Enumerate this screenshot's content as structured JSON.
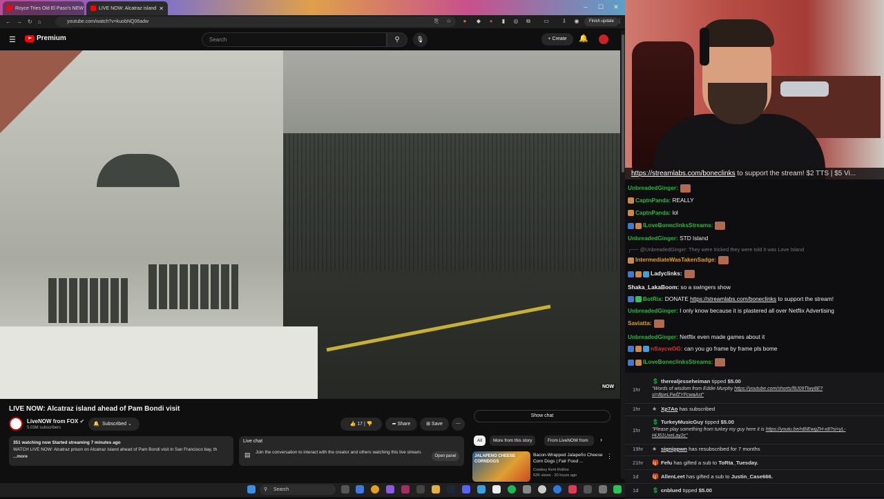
{
  "browser": {
    "tabs": [
      {
        "label": "Royce Tries Old El Paso's NEW"
      },
      {
        "label": "LIVE NOW: Alcatraz island"
      }
    ],
    "url": "youtube.com/watch?v=kuobNQ06adw",
    "finish_update": "Finish update"
  },
  "youtube": {
    "logo_text": "Premium",
    "search_placeholder": "Search",
    "create_label": "Create",
    "video": {
      "watermark": "NOW",
      "title": "LIVE NOW: Alcatraz island ahead of Pam Bondi visit",
      "channel": "LiveNOW from FOX",
      "subscribers": "5.03M subscribers",
      "subscribed_label": "Subscribed",
      "likes": "17",
      "share_label": "Share",
      "save_label": "Save",
      "desc_stats": "351 watching now  Started streaming 7 minutes ago",
      "desc_text": "WATCH LIVE NOW: Alcatraz prison on Alcatraz island ahead of Pam Bondi visit in San Francisco bay, the attorney general is visiting the famous prison after President Trump floated the idea of re",
      "desc_more": "...more"
    },
    "livechat": {
      "heading": "Live chat",
      "text": "Join the conversation to interact with the creator and others watching this live stream.",
      "open_panel": "Open panel"
    },
    "show_chat": "Show chat",
    "chips": [
      "All",
      "More from this story",
      "From LiveNOW from"
    ],
    "recommendation": {
      "thumb_text": "JALAPENO CHEESE CORNDOGS",
      "title": "Bacon-Wrapped Jalapeño Cheese Corn Dogs | Fair Food ...",
      "channel": "Cowboy Kent Rollins",
      "meta": "62K views · 20 hours ago"
    }
  },
  "taskbar": {
    "search_placeholder": "Search"
  },
  "stream": {
    "ticker_link": "https://streamlabs.com/boneclinks",
    "ticker_rest": " to support the stream! $2 TTS | $5 Vi..."
  },
  "chat": [
    {
      "user": "UnbreadedGinger:",
      "color": "#28b83c",
      "msg": "",
      "emote": true
    },
    {
      "user": "CaptnPanda:",
      "color": "#28b83c",
      "msg": " REALLY"
    },
    {
      "user": "CaptnPanda:",
      "color": "#28b83c",
      "msg": " lol"
    },
    {
      "user": "ILoveBoneclinksStreams:",
      "color": "#28b83c",
      "msg": "",
      "emote": true
    },
    {
      "user": "UnbreadedGinger:",
      "color": "#28b83c",
      "msg": " STD Island"
    },
    {
      "user": "@UnbreadedGinger:",
      "color": "#777",
      "msg": " They were tricked they were told it was Love Island",
      "reply": true
    },
    {
      "user": "IntermediateWasTakenSadge:",
      "color": "#e0a020",
      "msg": "",
      "emote": true
    },
    {
      "user": "Ladyclinks:",
      "color": "#efeff1",
      "msg": "",
      "emote": true
    },
    {
      "user": "Shaka_LakaBoom:",
      "color": "#efeff1",
      "msg": " so a swingers show"
    },
    {
      "user": "BotRix:",
      "color": "#28b83c",
      "msg": " DONATE ",
      "link": "https://streamlabs.com/boneclinks",
      "after": " to support the stream!"
    },
    {
      "user": "UnbreadedGinger:",
      "color": "#28b83c",
      "msg": " I only know because it is plastered all over Netflix Advertising"
    },
    {
      "user": "Saviatta:",
      "color": "#e0a020",
      "msg": "",
      "emote": true
    },
    {
      "user": "UnbreadedGinger:",
      "color": "#28b83c",
      "msg": " Netflix even made games about it"
    },
    {
      "user": "nSaycwOG:",
      "color": "#e03030",
      "msg": " can you go frame by frame pls bome"
    },
    {
      "user": "ILoveBoneclinksStreams:",
      "color": "#28b83c",
      "msg": "",
      "emote": true
    }
  ],
  "alerts": [
    {
      "time": "1hr",
      "user": "therealjesseheiman",
      "text": " tipped ",
      "amount": "$5.00",
      "quote1": "\"Words of wisdom from Eddie Murphy ",
      "link1": "https://youtube.com/shorts/f8J09Tlwy8E?",
      "link2": "si=BpeLFwfZYFcwaAst\""
    },
    {
      "time": "1hr",
      "user": "Xp7Ao",
      "text": " has subscribed"
    },
    {
      "time": "1hr",
      "user": "TurkeyMusicGuy",
      "text": " tipped ",
      "amount": "$5.00",
      "quote1": "\"Please play something from turkey my guy here it is ",
      "link1": "https://youtu.be/nBIEwgZH-x8?si=yL-",
      "link2": "HiJ61UxeLay2c\""
    },
    {
      "time": "19hr",
      "user": "signippwn",
      "text": " has resubscribed for 7 months"
    },
    {
      "time": "21hr",
      "user": "Fefu",
      "text": " has gifted a sub to ",
      "target": "ToRta_Tuesday."
    },
    {
      "time": "1d",
      "user": "AllenLeet",
      "text": " has gifted a sub to ",
      "target": "Justin_Case666."
    },
    {
      "time": "1d",
      "user": "cnblued",
      "text": " tipped ",
      "amount": "$5.00"
    }
  ]
}
